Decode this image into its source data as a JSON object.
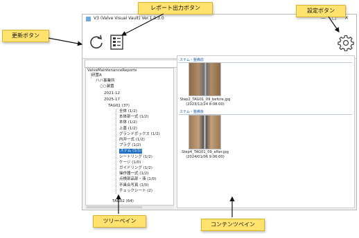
{
  "window": {
    "title": "V3 (Valve Visual Vault)  Ver.1.0.3.0",
    "controls": {
      "minimize": "—",
      "maximize": "□",
      "close": "✕"
    }
  },
  "callouts": {
    "refresh": "更新ボタン",
    "report": "レポート出力ボタン",
    "settings": "設定ボタン",
    "tree": "ツリーペイン",
    "content": "コンテンツペイン"
  },
  "icons": {
    "refresh": "refresh-icon",
    "report": "report-icon",
    "settings": "gear-icon",
    "filter": "filter-icon",
    "arrow": "arrow-right-icon"
  },
  "tree": {
    "root": "ValveMaintenanceReports",
    "n1": "研置A",
    "n2": "ハハ事業所",
    "n3": "○○装置",
    "n4": "2021-12",
    "n5": "2025-17",
    "n6": "TAG01 (37)",
    "items": [
      "全体 (1/2)",
      "本体部一式 (1/2)",
      "本体 (1/2)",
      "上蓋 (1/2)",
      "グランドボックス (1/2)",
      "内弁一式 (1/2)",
      "プラグ (1/2)",
      "ステム (1/1)",
      "シートリング (1/2)",
      "ケージ (1/0)",
      "ガイドリング (1/2)",
      "操作器一式 (1/2)",
      "点検部品部・液 (1/0)",
      "不具合写真 (1/0)",
      "チェックシート (2)"
    ],
    "n7": "TAG02 (64)"
  },
  "content": {
    "section1": "ステム・整備前",
    "photo1_name": "Step2_TAG01_09_before.jpg",
    "photo1_date": "(2023/12/24 8:08:00)",
    "section2": "ステム・整備後",
    "photo2_name": "Step4_TAG01_09_after.jpg",
    "photo2_date": "(2024/01/06 9:06:00)"
  },
  "colors": {
    "callout": "#ffe36e",
    "selection": "#1f6fc5",
    "section": "#1f5fa8"
  }
}
